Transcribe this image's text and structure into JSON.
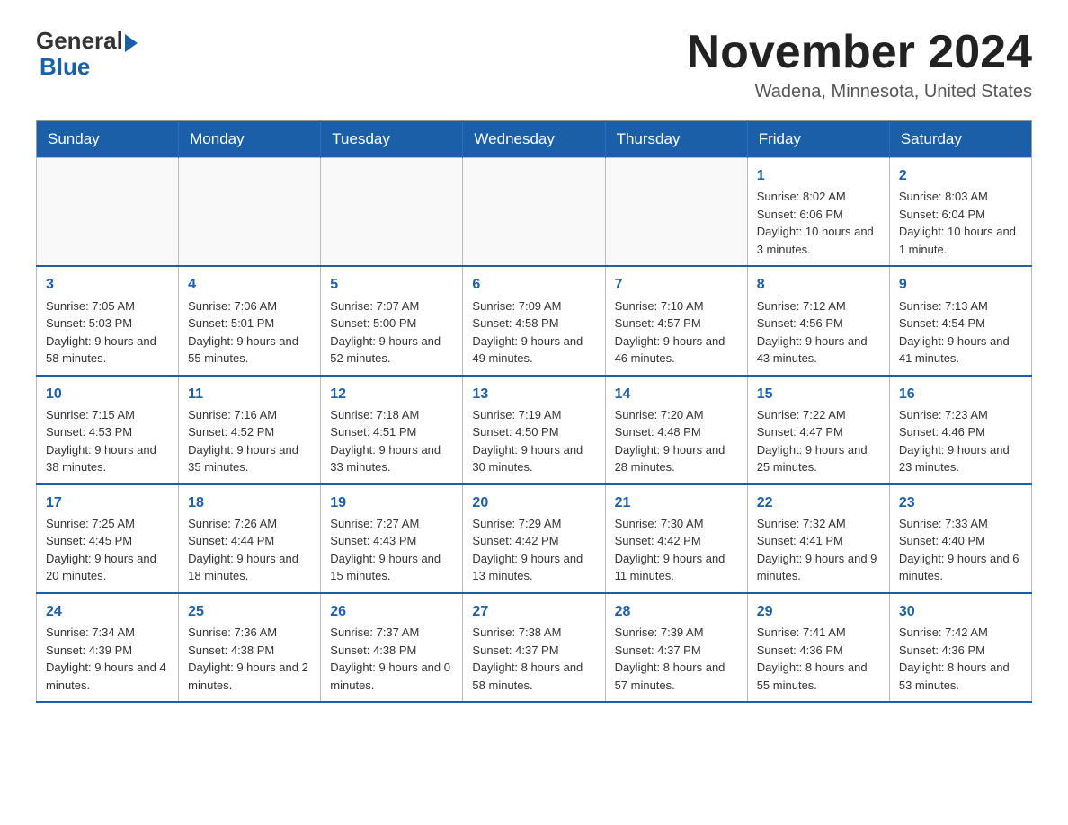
{
  "logo": {
    "general": "General",
    "blue": "Blue"
  },
  "header": {
    "title": "November 2024",
    "location": "Wadena, Minnesota, United States"
  },
  "days_of_week": [
    "Sunday",
    "Monday",
    "Tuesday",
    "Wednesday",
    "Thursday",
    "Friday",
    "Saturday"
  ],
  "weeks": [
    [
      {
        "day": "",
        "info": ""
      },
      {
        "day": "",
        "info": ""
      },
      {
        "day": "",
        "info": ""
      },
      {
        "day": "",
        "info": ""
      },
      {
        "day": "",
        "info": ""
      },
      {
        "day": "1",
        "info": "Sunrise: 8:02 AM\nSunset: 6:06 PM\nDaylight: 10 hours and 3 minutes."
      },
      {
        "day": "2",
        "info": "Sunrise: 8:03 AM\nSunset: 6:04 PM\nDaylight: 10 hours and 1 minute."
      }
    ],
    [
      {
        "day": "3",
        "info": "Sunrise: 7:05 AM\nSunset: 5:03 PM\nDaylight: 9 hours and 58 minutes."
      },
      {
        "day": "4",
        "info": "Sunrise: 7:06 AM\nSunset: 5:01 PM\nDaylight: 9 hours and 55 minutes."
      },
      {
        "day": "5",
        "info": "Sunrise: 7:07 AM\nSunset: 5:00 PM\nDaylight: 9 hours and 52 minutes."
      },
      {
        "day": "6",
        "info": "Sunrise: 7:09 AM\nSunset: 4:58 PM\nDaylight: 9 hours and 49 minutes."
      },
      {
        "day": "7",
        "info": "Sunrise: 7:10 AM\nSunset: 4:57 PM\nDaylight: 9 hours and 46 minutes."
      },
      {
        "day": "8",
        "info": "Sunrise: 7:12 AM\nSunset: 4:56 PM\nDaylight: 9 hours and 43 minutes."
      },
      {
        "day": "9",
        "info": "Sunrise: 7:13 AM\nSunset: 4:54 PM\nDaylight: 9 hours and 41 minutes."
      }
    ],
    [
      {
        "day": "10",
        "info": "Sunrise: 7:15 AM\nSunset: 4:53 PM\nDaylight: 9 hours and 38 minutes."
      },
      {
        "day": "11",
        "info": "Sunrise: 7:16 AM\nSunset: 4:52 PM\nDaylight: 9 hours and 35 minutes."
      },
      {
        "day": "12",
        "info": "Sunrise: 7:18 AM\nSunset: 4:51 PM\nDaylight: 9 hours and 33 minutes."
      },
      {
        "day": "13",
        "info": "Sunrise: 7:19 AM\nSunset: 4:50 PM\nDaylight: 9 hours and 30 minutes."
      },
      {
        "day": "14",
        "info": "Sunrise: 7:20 AM\nSunset: 4:48 PM\nDaylight: 9 hours and 28 minutes."
      },
      {
        "day": "15",
        "info": "Sunrise: 7:22 AM\nSunset: 4:47 PM\nDaylight: 9 hours and 25 minutes."
      },
      {
        "day": "16",
        "info": "Sunrise: 7:23 AM\nSunset: 4:46 PM\nDaylight: 9 hours and 23 minutes."
      }
    ],
    [
      {
        "day": "17",
        "info": "Sunrise: 7:25 AM\nSunset: 4:45 PM\nDaylight: 9 hours and 20 minutes."
      },
      {
        "day": "18",
        "info": "Sunrise: 7:26 AM\nSunset: 4:44 PM\nDaylight: 9 hours and 18 minutes."
      },
      {
        "day": "19",
        "info": "Sunrise: 7:27 AM\nSunset: 4:43 PM\nDaylight: 9 hours and 15 minutes."
      },
      {
        "day": "20",
        "info": "Sunrise: 7:29 AM\nSunset: 4:42 PM\nDaylight: 9 hours and 13 minutes."
      },
      {
        "day": "21",
        "info": "Sunrise: 7:30 AM\nSunset: 4:42 PM\nDaylight: 9 hours and 11 minutes."
      },
      {
        "day": "22",
        "info": "Sunrise: 7:32 AM\nSunset: 4:41 PM\nDaylight: 9 hours and 9 minutes."
      },
      {
        "day": "23",
        "info": "Sunrise: 7:33 AM\nSunset: 4:40 PM\nDaylight: 9 hours and 6 minutes."
      }
    ],
    [
      {
        "day": "24",
        "info": "Sunrise: 7:34 AM\nSunset: 4:39 PM\nDaylight: 9 hours and 4 minutes."
      },
      {
        "day": "25",
        "info": "Sunrise: 7:36 AM\nSunset: 4:38 PM\nDaylight: 9 hours and 2 minutes."
      },
      {
        "day": "26",
        "info": "Sunrise: 7:37 AM\nSunset: 4:38 PM\nDaylight: 9 hours and 0 minutes."
      },
      {
        "day": "27",
        "info": "Sunrise: 7:38 AM\nSunset: 4:37 PM\nDaylight: 8 hours and 58 minutes."
      },
      {
        "day": "28",
        "info": "Sunrise: 7:39 AM\nSunset: 4:37 PM\nDaylight: 8 hours and 57 minutes."
      },
      {
        "day": "29",
        "info": "Sunrise: 7:41 AM\nSunset: 4:36 PM\nDaylight: 8 hours and 55 minutes."
      },
      {
        "day": "30",
        "info": "Sunrise: 7:42 AM\nSunset: 4:36 PM\nDaylight: 8 hours and 53 minutes."
      }
    ]
  ]
}
